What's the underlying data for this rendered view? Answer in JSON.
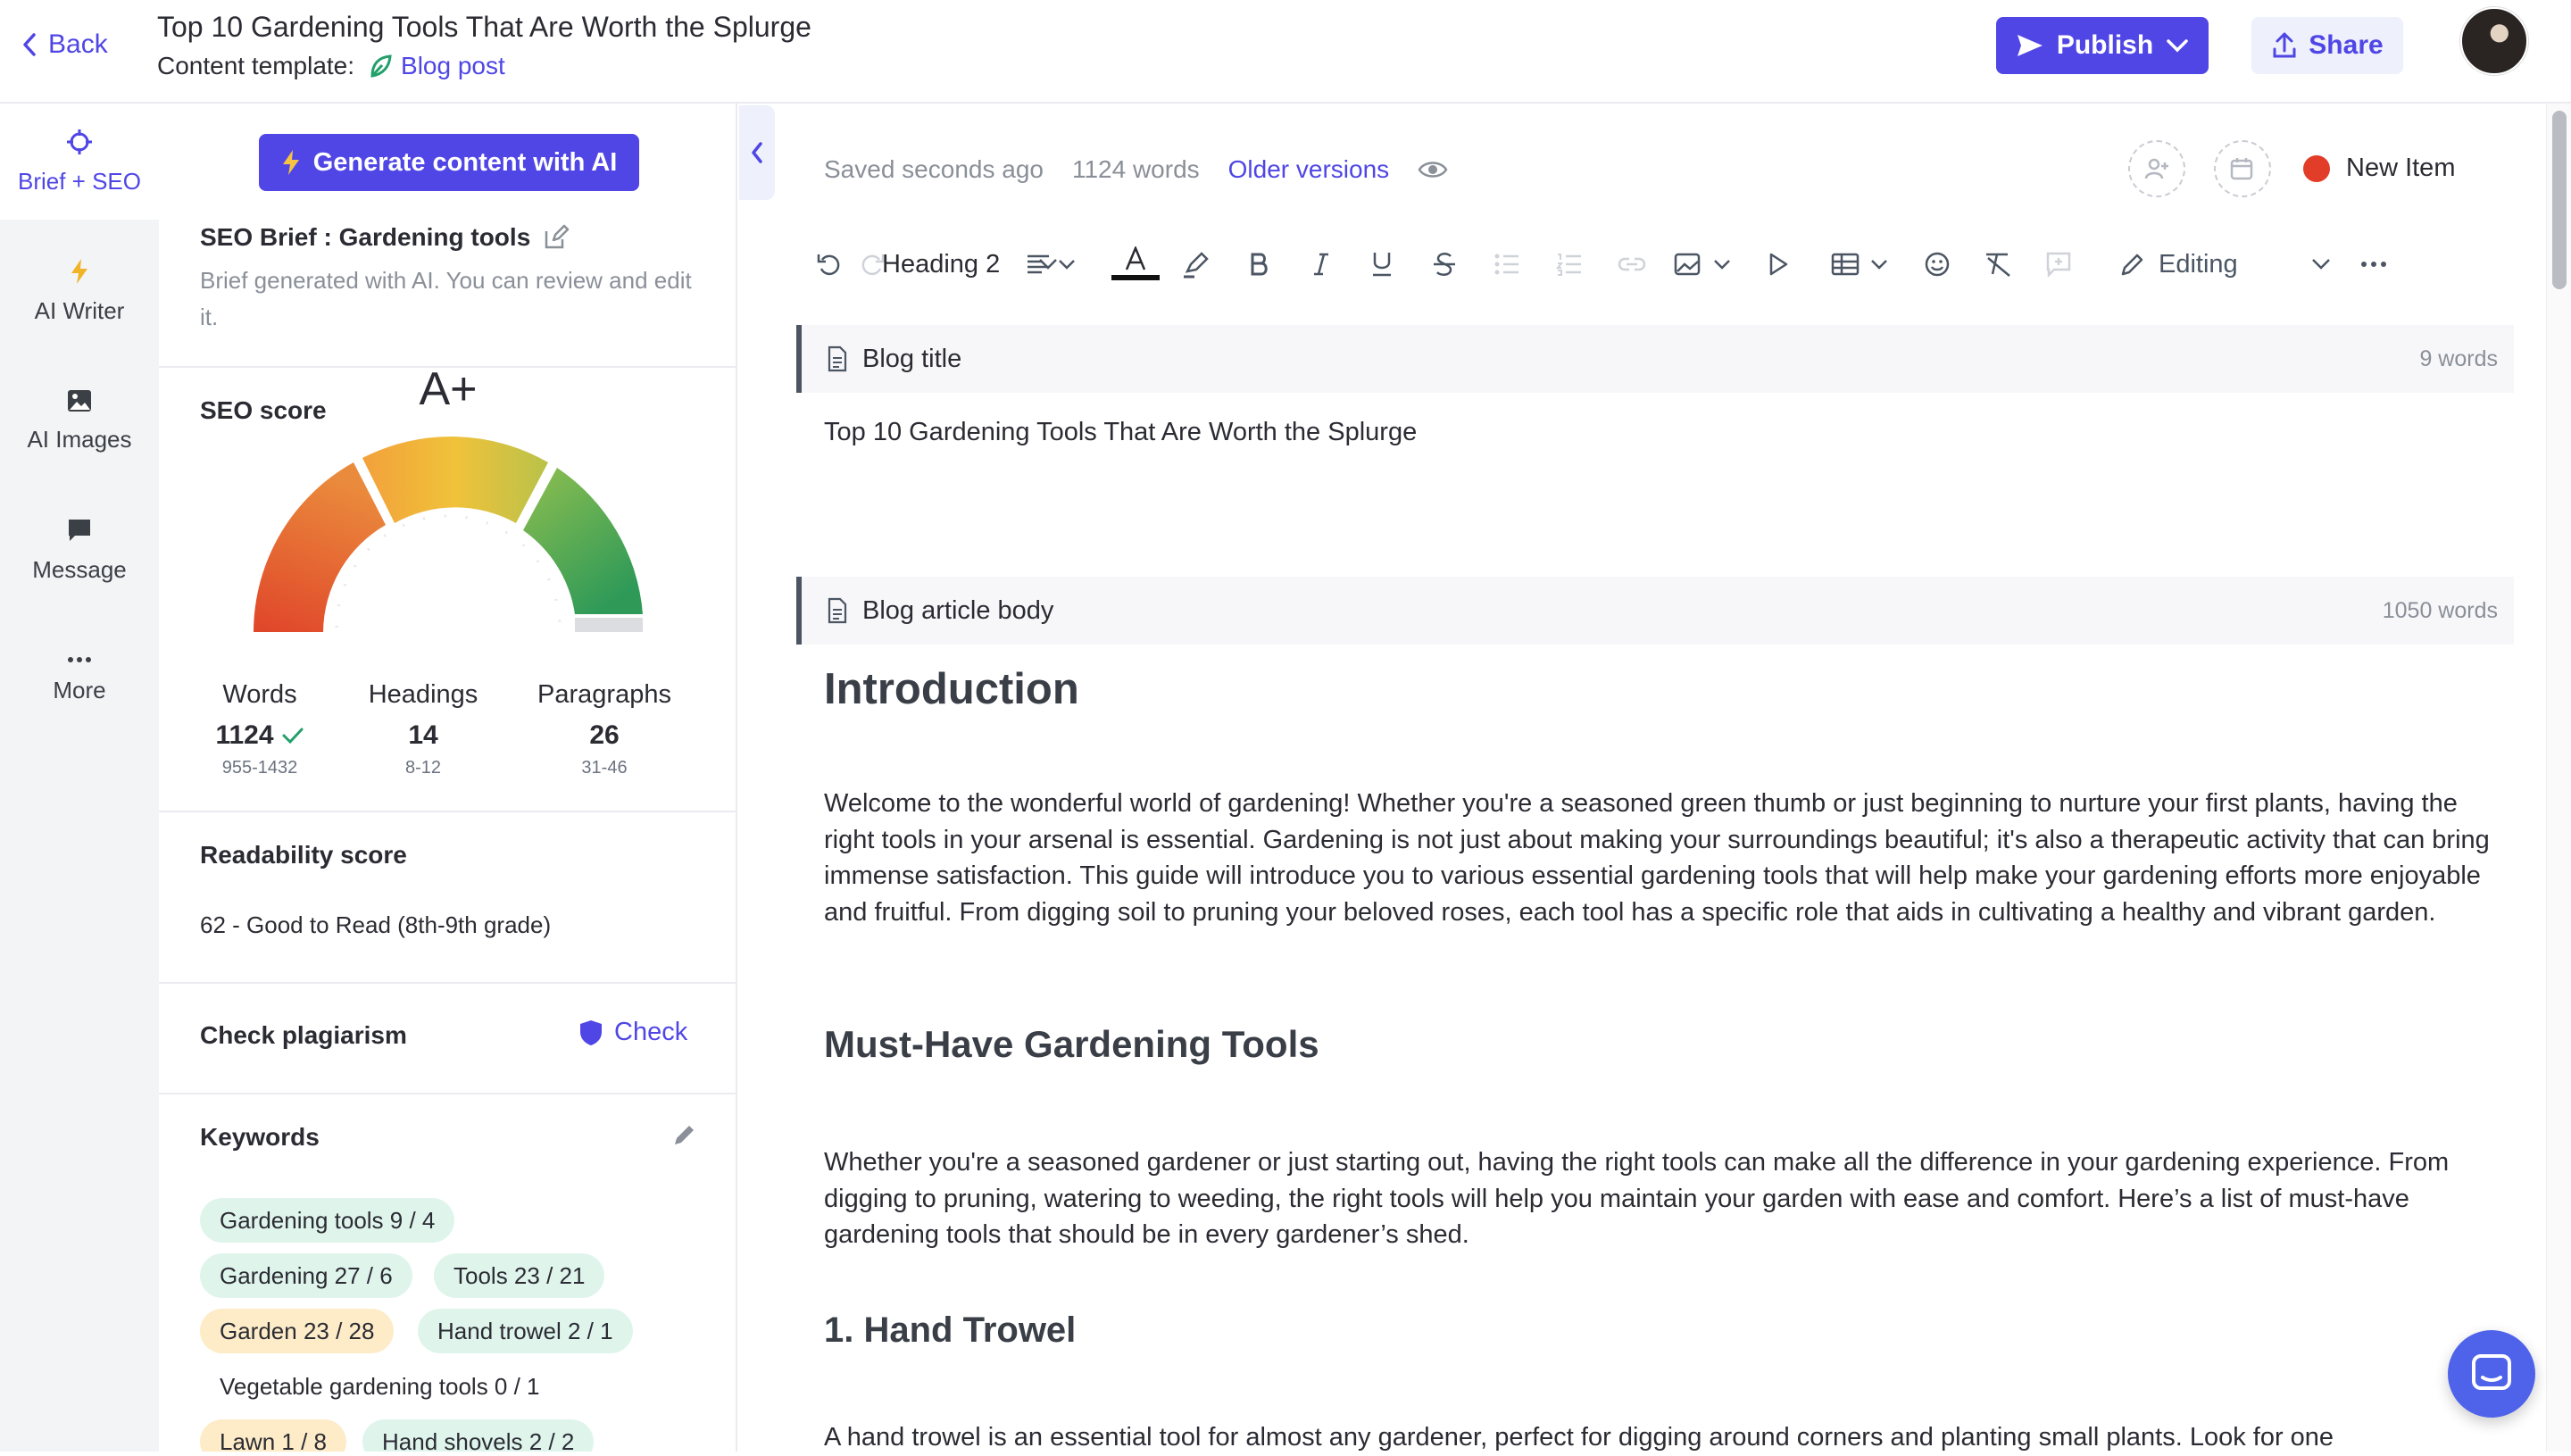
{
  "header": {
    "back_label": "Back",
    "title": "Top 10 Gardening Tools That Are Worth the Splurge",
    "template_label": "Content template:",
    "template_link": "Blog post",
    "publish_label": "Publish",
    "share_label": "Share"
  },
  "nav": {
    "items": [
      {
        "label": "Brief + SEO",
        "icon": "crosshair-icon",
        "active": true
      },
      {
        "label": "AI Writer",
        "icon": "lightning-icon",
        "active": false
      },
      {
        "label": "AI Images",
        "icon": "image-icon",
        "active": false
      },
      {
        "label": "Message",
        "icon": "chat-icon",
        "active": false
      },
      {
        "label": "More",
        "icon": "more-dots-icon",
        "active": false
      }
    ]
  },
  "seo": {
    "generate_label": "Generate content with AI",
    "brief_title": "SEO Brief : Gardening tools",
    "brief_desc": "Brief generated with AI. You can review and edit it.",
    "score_title": "SEO score",
    "grade": "A+",
    "stats": [
      {
        "label": "Words",
        "value": "1124",
        "range": "955-1432"
      },
      {
        "label": "Headings",
        "value": "14",
        "range": "8-12"
      },
      {
        "label": "Paragraphs",
        "value": "26",
        "range": "31-46"
      }
    ],
    "readability_title": "Readability score",
    "readability_value": "62 - Good to Read (8th-9th grade)",
    "plagiarism_title": "Check plagiarism",
    "check_label": "Check",
    "keywords_title": "Keywords",
    "keywords": [
      {
        "text": "Gardening tools   9 / 4",
        "status": "green"
      },
      {
        "text": "Gardening   27 / 6",
        "status": "green"
      },
      {
        "text": "Tools   23 / 21",
        "status": "green"
      },
      {
        "text": "Garden   23 / 28",
        "status": "yellow"
      },
      {
        "text": "Hand trowel   2 / 1",
        "status": "green"
      },
      {
        "text": "Vegetable gardening tools   0 / 1",
        "status": "plain"
      },
      {
        "text": "Lawn   1 / 8",
        "status": "yellow"
      },
      {
        "text": "Hand shovels   2 / 2",
        "status": "green"
      }
    ]
  },
  "editor": {
    "saved": "Saved seconds ago",
    "word_count": "1124 words",
    "older_versions": "Older versions",
    "new_item": "New Item",
    "heading_select": "Heading 2",
    "editing_select": "Editing",
    "title_block": {
      "label": "Blog title",
      "count": "9 words",
      "text": "Top 10 Gardening Tools That Are Worth the Splurge"
    },
    "body_block": {
      "label": "Blog article body",
      "count": "1050 words"
    },
    "content": {
      "h_intro": "Introduction",
      "p_intro": "Welcome to the wonderful world of gardening! Whether you're a seasoned green thumb or just beginning to nurture your first plants, having the right tools in your arsenal is essential. Gardening is not just about making your surroundings beautiful; it's also a therapeutic activity that can bring immense satisfaction. This guide will introduce you to various essential gardening tools that will help make your gardening efforts more enjoyable and fruitful. From digging soil to pruning your beloved roses, each tool has a specific role that aids in cultivating a healthy and vibrant garden.",
      "h_must": "Must-Have Gardening Tools",
      "p_must": "Whether you're a seasoned gardener or just starting out, having the right tools can make all the difference in your gardening experience. From digging to pruning, watering to weeding, the right tools will help you maintain your garden with ease and comfort. Here’s a list of must-have gardening tools that should be in every gardener’s shed.",
      "h_trowel": "1. Hand Trowel",
      "p_trowel": "A hand trowel is an essential tool for almost any gardener, perfect for digging around corners and planting small plants. Look for one"
    }
  },
  "colors": {
    "accent": "#5046e5",
    "keyword_green": "#dff5ec",
    "keyword_yellow": "#fdecc7",
    "status_red": "#e23d28"
  }
}
